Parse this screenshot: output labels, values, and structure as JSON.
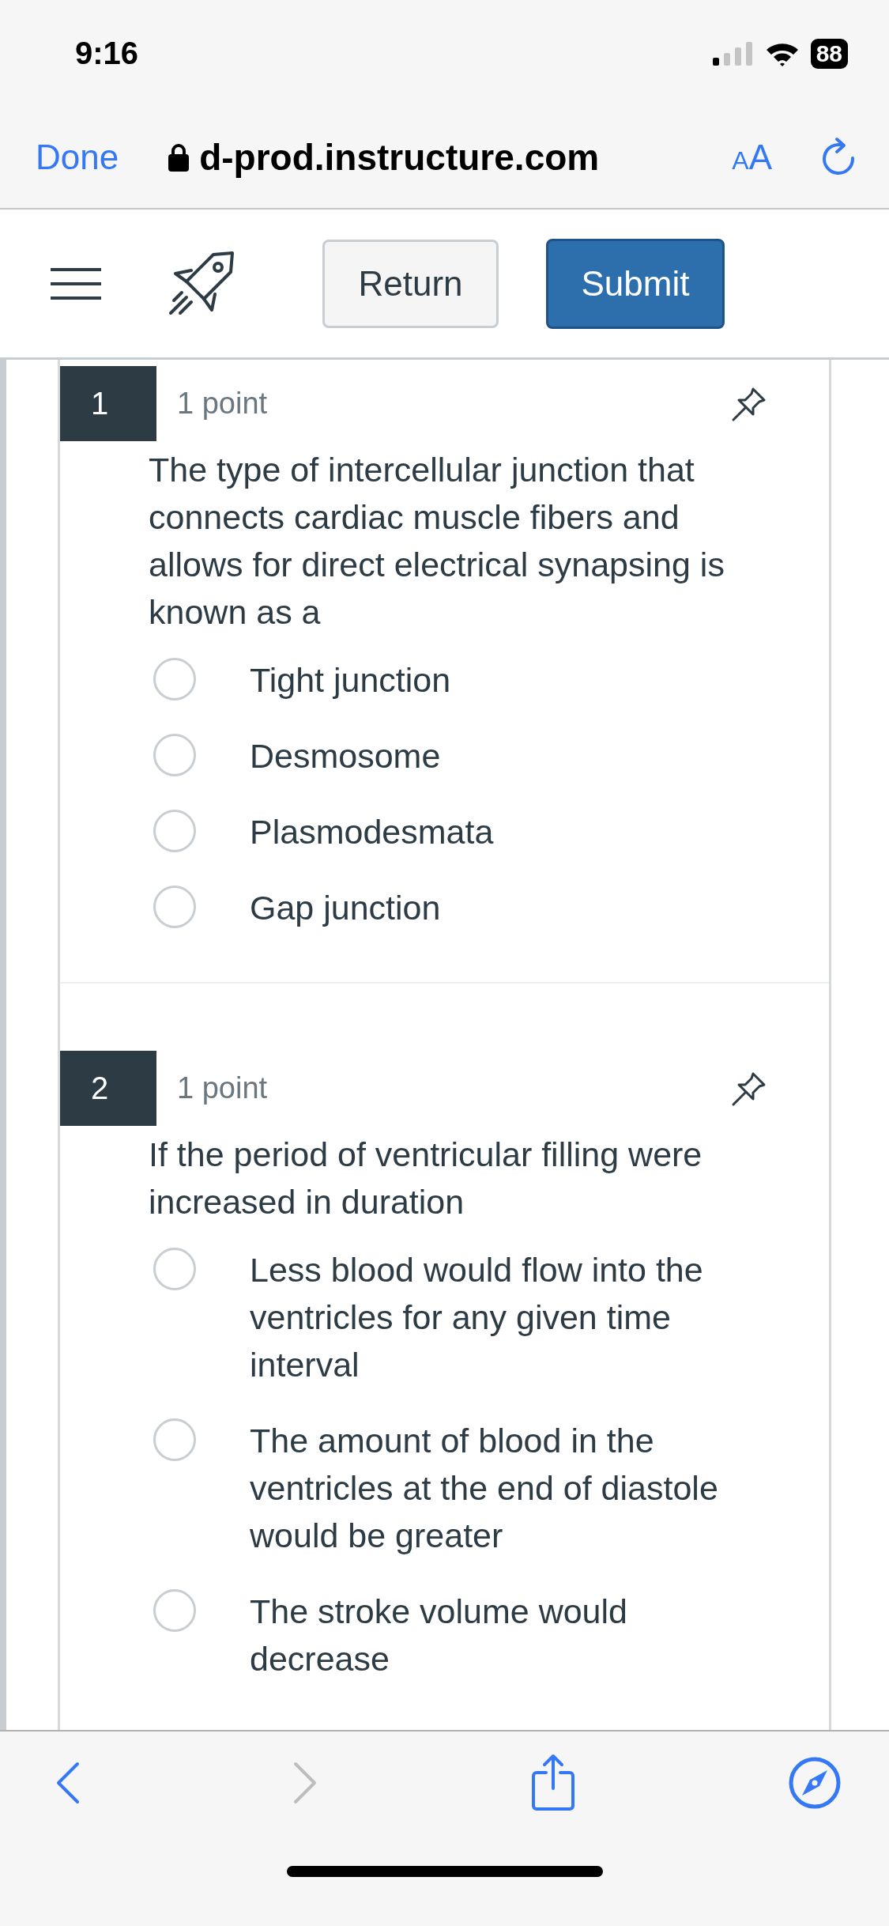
{
  "status_bar": {
    "time": "9:16",
    "battery": "88"
  },
  "browser": {
    "done": "Done",
    "url": "d-prod.instructure.com",
    "text_size_small": "A",
    "text_size_large": "A"
  },
  "toolbar": {
    "return": "Return",
    "submit": "Submit"
  },
  "questions": [
    {
      "number": "1",
      "points": "1 point",
      "text": "The type of intercellular junction that connects cardiac muscle fibers and allows for direct electrical synapsing is known as a",
      "options": [
        {
          "label": "Tight junction",
          "selected": false
        },
        {
          "label": "Desmosome",
          "selected": false
        },
        {
          "label": "Plasmodesmata",
          "selected": false
        },
        {
          "label": "Gap junction",
          "selected": false
        }
      ]
    },
    {
      "number": "2",
      "points": "1 point",
      "text": "If the period of ventricular filling were increased in duration",
      "options": [
        {
          "label": "Less blood would flow into the ventricles for any given time interval",
          "selected": false
        },
        {
          "label": "The amount of blood in the ventricles at the end of diastole would be greater",
          "selected": false
        },
        {
          "label": "The stroke volume would decrease",
          "selected": false
        }
      ]
    }
  ]
}
